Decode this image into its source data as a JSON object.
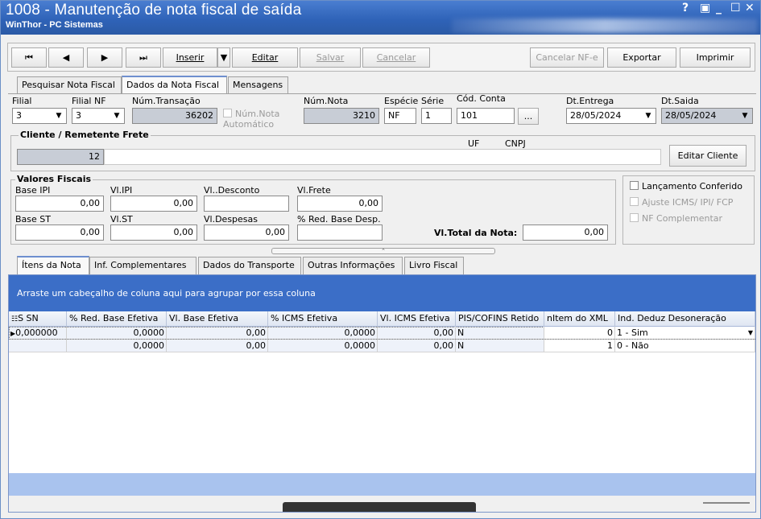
{
  "window": {
    "title": "1008 - Manutenção de nota fiscal de saída",
    "subtitle": "WinThor - PC Sistemas",
    "controls": [
      "?",
      "▣",
      "_",
      "☐",
      "✕"
    ]
  },
  "toolbar": {
    "first": "⏮",
    "prev": "◀",
    "next": "▶",
    "last": "⏭",
    "inserir": "Inserir",
    "editar": "Editar",
    "salvar": "Salvar",
    "cancelar": "Cancelar",
    "cancelar_nfe": "Cancelar NF-e",
    "exportar": "Exportar",
    "imprimir": "Imprimir"
  },
  "top_tabs": [
    "Pesquisar Nota Fiscal",
    "Dados da Nota Fiscal",
    "Mensagens"
  ],
  "header": {
    "filial_label": "Filial",
    "filial_value": "3",
    "filial_nf_label": "Filial NF",
    "filial_nf_value": "3",
    "num_transacao_label": "Núm.Transação",
    "num_transacao_value": "36202",
    "num_nota_auto_label": "Núm.Nota Automático",
    "num_nota_label": "Núm.Nota",
    "num_nota_value": "3210",
    "especie_label": "Espécie",
    "especie_value": "NF",
    "serie_label": "Série",
    "serie_value": "1",
    "cod_conta_label": "Cód. Conta",
    "cod_conta_value": "101",
    "cod_conta_button": "...",
    "dt_entrega_label": "Dt.Entrega",
    "dt_entrega_value": "28/05/2024",
    "dt_saida_label": "Dt.Saida",
    "dt_saida_value": "28/05/2024"
  },
  "cliente": {
    "title": "Cliente / Remetente Frete",
    "code": "12",
    "uf_label": "UF",
    "cnpj_label": "CNPJ",
    "edit_button": "Editar Cliente"
  },
  "valores": {
    "title": "Valores Fiscais",
    "base_ipi_label": "Base IPI",
    "base_ipi": "0,00",
    "vl_ipi_label": "Vl.IPI",
    "vl_ipi": "0,00",
    "vl_desconto_label": "Vl..Desconto",
    "vl_desconto": "",
    "vl_frete_label": "Vl.Frete",
    "vl_frete": "0,00",
    "base_st_label": "Base ST",
    "base_st": "0,00",
    "vl_st_label": "Vl.ST",
    "vl_st": "0,00",
    "vl_despesas_label": "Vl.Despesas",
    "vl_despesas": "0,00",
    "red_base_desp_label": "% Red. Base Desp.",
    "red_base_desp": "",
    "vl_total_label": "Vl.Total da Nota:",
    "vl_total": "0,00"
  },
  "checks": [
    {
      "label": "Lançamento Conferido",
      "enabled": true
    },
    {
      "label": "Ajuste ICMS/ IPI/ FCP",
      "enabled": false
    },
    {
      "label": "NF Complementar",
      "enabled": false
    }
  ],
  "bottom_tabs": [
    "Ítens da Nota",
    "Inf. Complementares",
    "Dados do Transporte",
    "Outras Informações",
    "Livro Fiscal"
  ],
  "grid": {
    "group_hint": "Arrastе um cabeçalho de coluna aqui para agrupar por essa coluna",
    "columns": [
      "S SN",
      "% Red. Base Efetiva",
      "Vl. Base Efetiva",
      "% ICMS Efetiva",
      "Vl. ICMS Efetiva",
      "PIS/COFINS Retido",
      "nItem do XML",
      "Ind. Deduz Desoneração"
    ],
    "rows": [
      [
        "0,000000",
        "0,0000",
        "0,00",
        "0,0000",
        "0,00",
        "N",
        "0",
        "1 - Sim"
      ],
      [
        "",
        "0,0000",
        "0,00",
        "0,0000",
        "0,00",
        "N",
        "1",
        "0 - Não"
      ]
    ]
  }
}
